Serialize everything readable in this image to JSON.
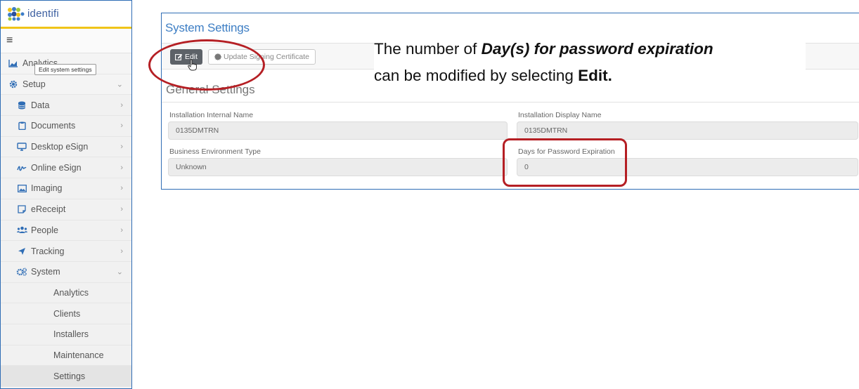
{
  "app": {
    "logo_text": "identifi"
  },
  "sidebar": {
    "menu_glyph": "≡",
    "items": [
      {
        "label": "Analytics",
        "icon": "area-chart-icon",
        "level": 0
      },
      {
        "label": "Setup",
        "icon": "gear-icon",
        "level": 0,
        "expanded": true
      },
      {
        "label": "Data",
        "icon": "database-icon",
        "level": 1
      },
      {
        "label": "Documents",
        "icon": "clipboard-icon",
        "level": 1
      },
      {
        "label": "Desktop eSign",
        "icon": "monitor-icon",
        "level": 1
      },
      {
        "label": "Online eSign",
        "icon": "signature-icon",
        "level": 1
      },
      {
        "label": "Imaging",
        "icon": "image-icon",
        "level": 1
      },
      {
        "label": "eReceipt",
        "icon": "receipt-icon",
        "level": 1
      },
      {
        "label": "People",
        "icon": "users-icon",
        "level": 1
      },
      {
        "label": "Tracking",
        "icon": "location-arrow-icon",
        "level": 1
      },
      {
        "label": "System",
        "icon": "cogs-icon",
        "level": 1,
        "expanded": true
      },
      {
        "label": "Analytics",
        "level": 2
      },
      {
        "label": "Clients",
        "level": 2
      },
      {
        "label": "Installers",
        "level": 2
      },
      {
        "label": "Maintenance",
        "level": 2
      },
      {
        "label": "Settings",
        "level": 2,
        "active": true
      }
    ]
  },
  "panel": {
    "title": "System Settings",
    "toolbar": {
      "edit_label": "Edit",
      "update_cert_label": "Update Signing Certificate",
      "edit_tooltip": "Edit system settings"
    },
    "section_title": "General Settings",
    "fields": {
      "internal_name": {
        "label": "Installation Internal Name",
        "value": "0135DMTRN"
      },
      "display_name": {
        "label": "Installation Display Name",
        "value": "0135DMTRN"
      },
      "business_env": {
        "label": "Business Environment Type",
        "value": "Unknown"
      },
      "password_expiration": {
        "label": "Days for Password Expiration",
        "value": "0"
      }
    }
  },
  "annotation": {
    "line1_prefix": "The number of ",
    "line1_emphasis": "Day(s) for password expiration",
    "line2_prefix": "can be modified by selecting ",
    "line2_emphasis": "Edit."
  },
  "colors": {
    "accent_blue": "#2f6db5",
    "title_blue": "#3d7ec4",
    "logo_underline": "#f0c419",
    "highlight_red": "#b51f24",
    "edit_button": "#5d6268"
  }
}
